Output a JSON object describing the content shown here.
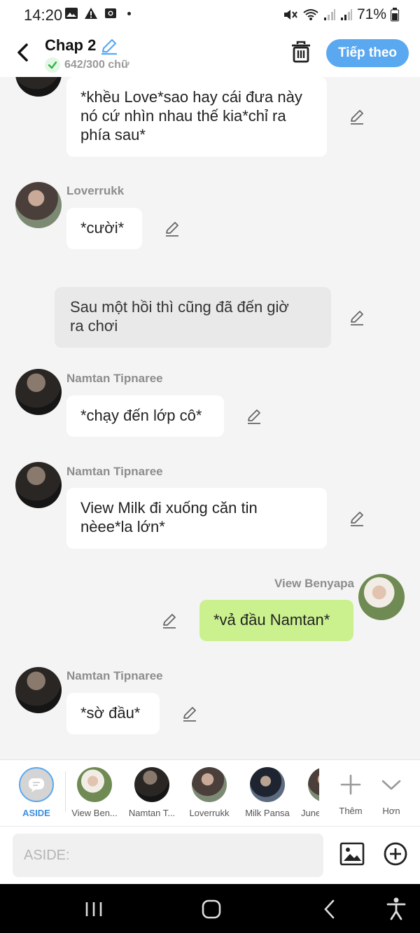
{
  "status_bar": {
    "time": "14:20",
    "battery": "71%"
  },
  "header": {
    "title": "Chap 2",
    "word_count": "642/300 chữ",
    "next_button": "Tiếp theo"
  },
  "messages": [
    {
      "type": "left",
      "text_lines": [
        "*khều Love*sao hay cái đưa này",
        "nó cứ nhìn nhau thế kia*chỉ ra",
        "phía sau*"
      ]
    },
    {
      "type": "left",
      "name": "Loverrukk",
      "text": "*cười*"
    },
    {
      "type": "narration",
      "text_lines": [
        "Sau một hồi thì cũng đã đến giờ",
        "ra chơi"
      ]
    },
    {
      "type": "left",
      "name": "Namtan Tipnaree",
      "text": "*chạy đến lớp cô*"
    },
    {
      "type": "left",
      "name": "Namtan Tipnaree",
      "text_lines": [
        "View Milk đi xuống căn tin",
        "nèee*la lớn*"
      ]
    },
    {
      "type": "right",
      "name": "View Benyapa",
      "text": "*vả đầu Namtan*"
    },
    {
      "type": "left",
      "name": "Namtan Tipnaree",
      "text": "*sờ đầu*"
    }
  ],
  "character_bar": {
    "aside_label": "ASIDE",
    "characters": [
      {
        "label": "View Ben..."
      },
      {
        "label": "Namtan T..."
      },
      {
        "label": "Loverrukk"
      },
      {
        "label": "Milk Pansa"
      },
      {
        "label": "June"
      }
    ],
    "add_label": "Thêm",
    "more_label": "Hơn"
  },
  "input": {
    "placeholder": "ASIDE:"
  },
  "colors": {
    "accent": "#5aa8f0",
    "my_bubble": "#cbf08e",
    "narration_bubble": "#e9e9e9"
  }
}
